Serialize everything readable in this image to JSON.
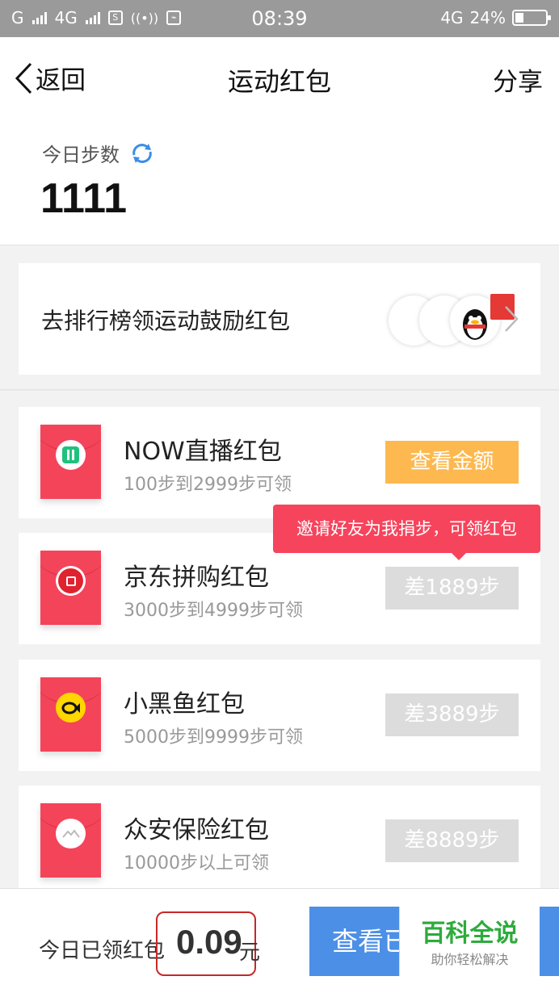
{
  "status_bar": {
    "carrier1": "G",
    "carrier2": "4G",
    "time": "08:39",
    "network": "4G",
    "battery": "24%"
  },
  "nav": {
    "back_label": "返回",
    "title": "运动红包",
    "share_label": "分享"
  },
  "steps": {
    "label": "今日步数",
    "value": "1111"
  },
  "ranking": {
    "text": "去排行榜领运动鼓励红包"
  },
  "packets": [
    {
      "name": "NOW直播红包",
      "range": "100步到2999步可领",
      "button": "查看金额",
      "icon": "now-live-icon"
    },
    {
      "name": "京东拼购红包",
      "range": "3000步到4999步可领",
      "button": "差1889步",
      "icon": "jd-pingou-icon"
    },
    {
      "name": "小黑鱼红包",
      "range": "5000步到9999步可领",
      "button": "差3889步",
      "icon": "black-fish-icon"
    },
    {
      "name": "众安保险红包",
      "range": "10000步以上可领",
      "button": "差8889步",
      "icon": "zhongan-icon"
    }
  ],
  "tooltip": "邀请好友为我捐步，可领红包",
  "bottom": {
    "label": "今日已领红包",
    "amount": "0.09",
    "unit": "元",
    "button": "查看已"
  },
  "watermark": {
    "title": "百科全说",
    "subtitle": "助你轻松解决"
  },
  "colors": {
    "accent_red": "#f4445a",
    "button_orange": "#fdb94f",
    "button_blue": "#4c8fe6",
    "watermark_green": "#2eab3c"
  }
}
